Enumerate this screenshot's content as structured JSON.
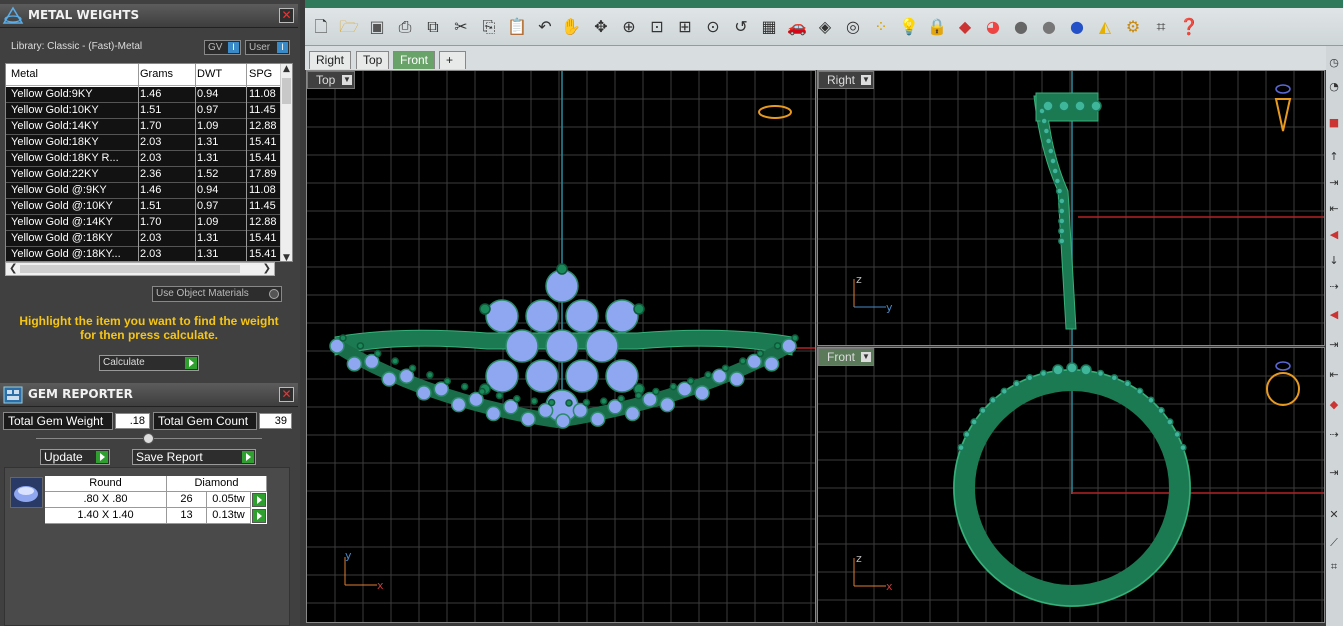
{
  "metal_weights": {
    "title": "METAL WEIGHTS",
    "library": "Library: Classic - (Fast)-Metal",
    "toggle_gv": "GV",
    "toggle_user": "User",
    "columns": [
      "Metal",
      "Grams",
      "DWT",
      "SPG"
    ],
    "rows": [
      [
        "Yellow Gold:9KY",
        "1.46",
        "0.94",
        "11.08"
      ],
      [
        "Yellow Gold:10KY",
        "1.51",
        "0.97",
        "11.45"
      ],
      [
        "Yellow Gold:14KY",
        "1.70",
        "1.09",
        "12.88"
      ],
      [
        "Yellow Gold:18KY",
        "2.03",
        "1.31",
        "15.41"
      ],
      [
        "Yellow Gold:18KY R...",
        "2.03",
        "1.31",
        "15.41"
      ],
      [
        "Yellow Gold:22KY",
        "2.36",
        "1.52",
        "17.89"
      ],
      [
        "Yellow Gold @:9KY",
        "1.46",
        "0.94",
        "11.08"
      ],
      [
        "Yellow Gold @:10KY",
        "1.51",
        "0.97",
        "11.45"
      ],
      [
        "Yellow Gold @:14KY",
        "1.70",
        "1.09",
        "12.88"
      ],
      [
        "Yellow Gold @:18KY",
        "2.03",
        "1.31",
        "15.41"
      ],
      [
        "Yellow Gold @:18KY...",
        "2.03",
        "1.31",
        "15.41"
      ]
    ],
    "use_object_materials": "Use Object Materials",
    "hint": "Highlight the item you want to find the weight for then press calculate.",
    "calculate": "Calculate"
  },
  "gem_reporter": {
    "title": "GEM REPORTER",
    "total_weight_label": "Total Gem Weight",
    "total_weight_value": ".18",
    "total_count_label": "Total Gem Count",
    "total_count_value": "39",
    "update": "Update",
    "save_report": "Save Report",
    "header": [
      "Round",
      "Diamond"
    ],
    "rows": [
      [
        ".80 X .80",
        "26",
        "0.05tw"
      ],
      [
        "1.40 X 1.40",
        "13",
        "0.13tw"
      ]
    ]
  },
  "tabs": [
    "Right",
    "Top",
    "Front",
    "+"
  ],
  "active_tab": "Front",
  "viewports": {
    "top": {
      "label": "Top",
      "axis_a": "y",
      "axis_b": "x"
    },
    "right": {
      "label": "Right",
      "axis_a": "z",
      "axis_b": "y"
    },
    "front": {
      "label": "Front",
      "axis_a": "z",
      "axis_b": "x"
    }
  },
  "colors": {
    "ring_green": "#1f8a5e",
    "gem_blue": "#8fa6f0",
    "grid": "#3c3c3c",
    "accent_yellow": "#f5c518"
  }
}
